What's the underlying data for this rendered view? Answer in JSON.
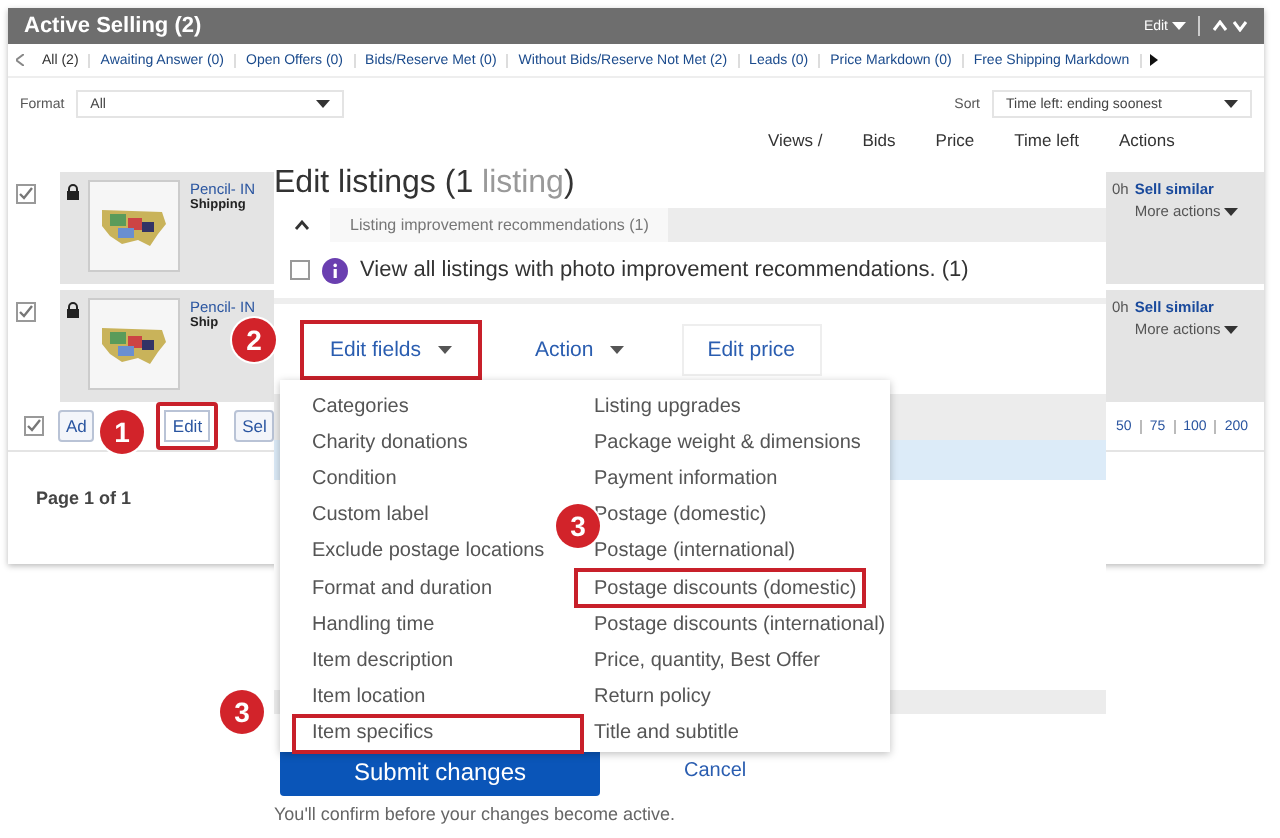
{
  "panel": {
    "title": "Active Selling (2)",
    "menu_label": "Edit"
  },
  "filter_tabs": [
    {
      "label": "All (2)",
      "selected": true
    },
    {
      "label": "Awaiting Answer (0)",
      "selected": false
    },
    {
      "label": "Open Offers (0)",
      "selected": false
    },
    {
      "label": "Bids/Reserve Met (0)",
      "selected": false
    },
    {
      "label": "Without Bids/Reserve Not Met (2)",
      "selected": false
    },
    {
      "label": "Leads (0)",
      "selected": false
    },
    {
      "label": "Price Markdown (0)",
      "selected": false
    },
    {
      "label": "Free Shipping Markdown",
      "selected": false
    }
  ],
  "format": {
    "label": "Format",
    "value": "All"
  },
  "sort": {
    "label": "Sort",
    "value": "Time left: ending soonest"
  },
  "columns": [
    "Views /",
    "Bids",
    "Price",
    "Time left",
    "Actions"
  ],
  "listings": [
    {
      "checked": true,
      "title": "Pencil- IN",
      "shipping": "Shipping",
      "time_left": "0h",
      "link": "Sell similar",
      "more": "More actions"
    },
    {
      "checked": true,
      "title": "Pencil- IN",
      "shipping": "Ship",
      "time_left": "0h",
      "link": "Sell similar",
      "more": "More actions"
    }
  ],
  "footer": {
    "checked": true,
    "buttons": [
      {
        "label": "Ad",
        "highlighted": false
      },
      {
        "label": "Edit",
        "highlighted": true
      },
      {
        "label": "Sel",
        "highlighted": false
      }
    ],
    "page_sizes": [
      "50",
      "75",
      "100",
      "200"
    ],
    "page_label": "Page 1 of 1"
  },
  "modal": {
    "title_parts": [
      {
        "text": "Edit listings (1 ",
        "muted": false
      },
      {
        "text": "listing",
        "muted": true
      },
      {
        "text": ")",
        "muted": false
      }
    ],
    "tab": "Listing improvement recommendations (1)",
    "photo_option": {
      "checked": false,
      "text": "View all listings with photo improvement recommendations. (1)"
    },
    "toolbar": [
      {
        "label": "Edit fields",
        "kind": "dropdown",
        "highlighted": true
      },
      {
        "label": "Action",
        "kind": "dropdown",
        "highlighted": false
      },
      {
        "label": "Edit price",
        "kind": "button",
        "highlighted": false
      }
    ],
    "field_menu": [
      [
        {
          "label": "Categories",
          "highlighted": false
        },
        {
          "label": "Charity donations",
          "highlighted": false
        },
        {
          "label": "Condition",
          "highlighted": false
        },
        {
          "label": "Custom label",
          "highlighted": false
        },
        {
          "label": "Exclude postage locations",
          "highlighted": false
        },
        {
          "label": "Format and duration",
          "highlighted": false
        },
        {
          "label": "Handling time",
          "highlighted": false
        },
        {
          "label": "Item description",
          "highlighted": false
        },
        {
          "label": "Item location",
          "highlighted": false
        },
        {
          "label": "Item specifics",
          "highlighted": true
        }
      ],
      [
        {
          "label": "Listing upgrades",
          "highlighted": false
        },
        {
          "label": "Package weight & dimensions",
          "highlighted": false
        },
        {
          "label": "Payment information",
          "highlighted": false
        },
        {
          "label": "Postage (domestic)",
          "highlighted": false
        },
        {
          "label": "Postage (international)",
          "highlighted": false
        },
        {
          "label": "Postage discounts (domestic)",
          "highlighted": true
        },
        {
          "label": "Postage discounts (international)",
          "highlighted": false
        },
        {
          "label": "Price, quantity, Best Offer",
          "highlighted": false
        },
        {
          "label": "Return policy",
          "highlighted": false
        },
        {
          "label": "Title and subtitle",
          "highlighted": false
        }
      ]
    ],
    "submit": "Submit changes",
    "cancel": "Cancel",
    "note": "You'll confirm before your changes become active."
  },
  "callouts": [
    "1",
    "2",
    "3",
    "3"
  ]
}
